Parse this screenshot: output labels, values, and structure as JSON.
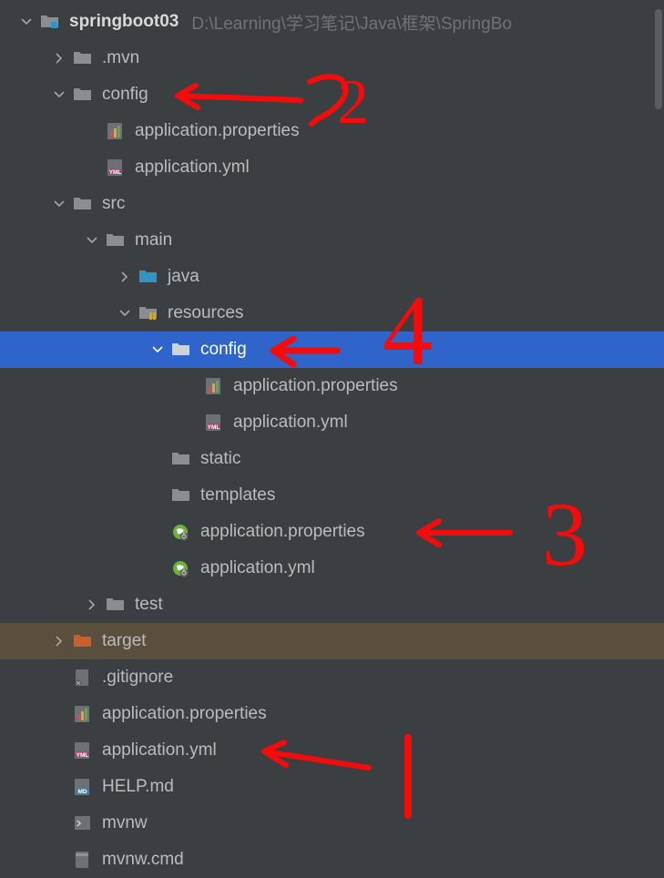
{
  "root": {
    "name": "springboot03",
    "path": "D:\\Learning\\学习笔记\\Java\\框架\\SpringBo"
  },
  "tree": {
    "mvn": ".mvn",
    "config": "config",
    "app_props": "application.properties",
    "app_yml": "application.yml",
    "src": "src",
    "main": "main",
    "java": "java",
    "resources": "resources",
    "res_config": "config",
    "res_cfg_props": "application.properties",
    "res_cfg_yml": "application.yml",
    "static": "static",
    "templates": "templates",
    "res_props": "application.properties",
    "res_yml": "application.yml",
    "test": "test",
    "target": "target",
    "gitignore": ".gitignore",
    "root_props": "application.properties",
    "root_yml": "application.yml",
    "help": "HELP.md",
    "mvnw": "mvnw",
    "mvnw_cmd": "mvnw.cmd"
  },
  "annot": {
    "n1": "1",
    "n2": "2",
    "n3": "3",
    "n4": "4"
  }
}
